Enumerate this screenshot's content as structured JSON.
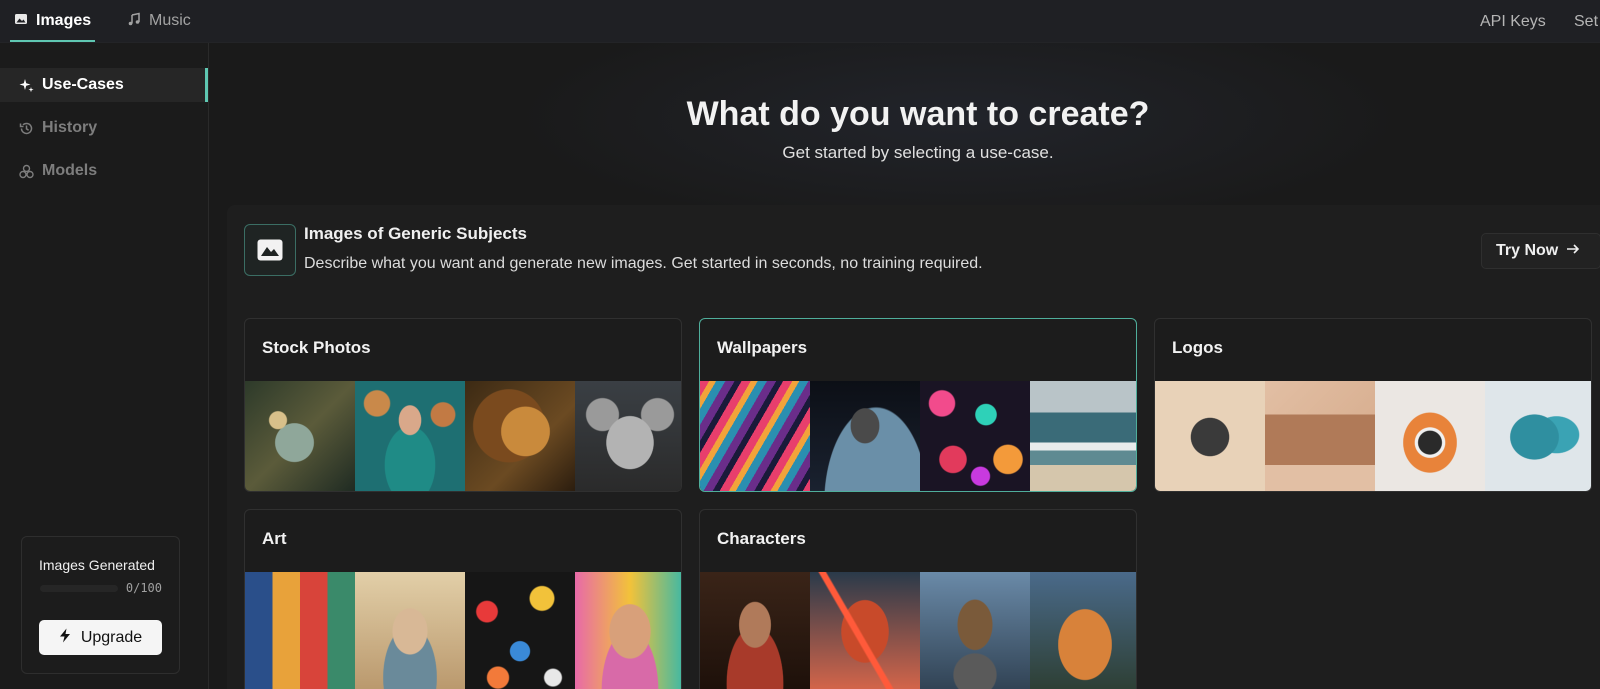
{
  "topbar": {
    "tabs": [
      {
        "label": "Images",
        "icon": "image-icon",
        "active": true
      },
      {
        "label": "Music",
        "icon": "music-note-icon",
        "active": false
      }
    ],
    "links": [
      "API Keys",
      "Set"
    ]
  },
  "sidebar": {
    "items": [
      {
        "label": "Use-Cases",
        "icon": "sparkles-icon",
        "active": true
      },
      {
        "label": "History",
        "icon": "history-icon",
        "active": false
      },
      {
        "label": "Models",
        "icon": "models-icon",
        "active": false
      }
    ],
    "usage": {
      "title": "Images Generated",
      "count": "0/100",
      "progress_fraction": 0,
      "upgrade_label": "Upgrade"
    }
  },
  "hero": {
    "title": "What do you want to create?",
    "subtitle": "Get started by selecting a use-case."
  },
  "use_case": {
    "title": "Images of Generic Subjects",
    "description": "Describe what you want and generate new images. Get started in seconds, no training required.",
    "try_label": "Try Now"
  },
  "cards": [
    {
      "title": "Stock Photos",
      "selected": false
    },
    {
      "title": "Wallpapers",
      "selected": true
    },
    {
      "title": "Logos",
      "selected": false
    },
    {
      "title": "Art",
      "selected": false
    },
    {
      "title": "Characters",
      "selected": false
    }
  ],
  "colors": {
    "accent": "#5fc7b2",
    "background": "#1a1a1a",
    "selected_border": "#4fae9b"
  }
}
